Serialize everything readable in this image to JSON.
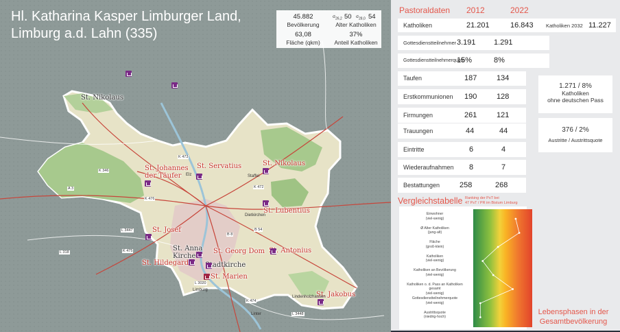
{
  "map": {
    "title_line1": "Hl. Katharina Kasper Limburger Land,",
    "title_line2": "Limburg a.d. Lahn (335)",
    "stats": {
      "bevoelkerung_value": "45.882",
      "bevoelkerung_label": "Bevölkerung",
      "sigma_a": "σ",
      "sigma_a_sub": "26,2",
      "alter_value": "50",
      "sigma_b": "σ",
      "sigma_b_sub": "28,0",
      "alter_value2": "54",
      "alter_label": "Alter Katholiken",
      "flaeche_value": "63,08",
      "flaeche_label": "Fläche (qkm)",
      "anteil_value": "37%",
      "anteil_label": "Anteil Katholiken"
    },
    "places": [
      {
        "id": "st-nikolaus-nord",
        "label": "St. Nikolaus"
      },
      {
        "id": "st-johannes",
        "label": "St. Johannes\nder Täufer"
      },
      {
        "id": "st-servatius",
        "label": "St. Servatius"
      },
      {
        "id": "st-nikolaus-ost",
        "label": "St. Nikolaus"
      },
      {
        "id": "st-lubentius",
        "label": "St. Lubentius"
      },
      {
        "id": "st-josef",
        "label": "St. Josef"
      },
      {
        "id": "st-anna",
        "label": "St. Anna\nKirche"
      },
      {
        "id": "st-georg",
        "label": "St. Georg Dom"
      },
      {
        "id": "stadtkirche",
        "label": "Stadtkirche"
      },
      {
        "id": "st-hildegard",
        "label": "St. Hildegard"
      },
      {
        "id": "st-antonius",
        "label": "St. Antonius"
      },
      {
        "id": "st-marien",
        "label": "St. Marien"
      },
      {
        "id": "st-jakobus",
        "label": "St. Jakobus"
      }
    ],
    "road_labels": [
      "A 3",
      "K 346",
      "L 3020",
      "K 472",
      "K 473",
      "B 8",
      "L 3447",
      "K 475",
      "B 54",
      "L 3448",
      "K 474",
      "L 318",
      "K 476"
    ],
    "town_labels": [
      "Elz",
      "Staffel",
      "Lindenholzhausen",
      "Linter",
      "Dietkirchen",
      "Limburg"
    ]
  },
  "pastoral": {
    "title": "Pastoraldaten",
    "year_a": "2012",
    "year_b": "2022",
    "rows": [
      {
        "label": "Katholiken",
        "a": "21.201",
        "b": "16.843",
        "extra_label": "Katholiken 2032",
        "extra_value": "11.227"
      },
      {
        "label": "Gottesdienstteilnehmer",
        "a": "3.191",
        "b": "1.291"
      },
      {
        "label": "Gottesdienstteilnehmerquote",
        "a": "15%",
        "b": "8%"
      },
      {
        "label": "Taufen",
        "a": "187",
        "b": "134"
      },
      {
        "label": "Erstkommunionen",
        "a": "190",
        "b": "128"
      },
      {
        "label": "Firmungen",
        "a": "261",
        "b": "121"
      },
      {
        "label": "Trauungen",
        "a": "44",
        "b": "44"
      },
      {
        "label": "Eintritte",
        "a": "6",
        "b": "4"
      },
      {
        "label": "Wiederaufnahmen",
        "a": "8",
        "b": "7"
      },
      {
        "label": "Bestattungen",
        "a": "258",
        "b": "268"
      }
    ],
    "side1_value": "1.271 / 8%",
    "side1_label1": "Katholiken",
    "side1_label2": "ohne deutschen Pass",
    "side2_value": "376 / 2%",
    "side2_label": "Austritte / Austrittsquote"
  },
  "vergleich": {
    "title": "Vergleichstabelle",
    "ranking_line1": "Ranking der PsT bei",
    "ranking_line2": "47 PsT / PR im Bistum Limburg",
    "indicators": [
      {
        "label": "Einwohner",
        "sub": "(viel-wenig)",
        "level": 0.72
      },
      {
        "label": "Ø Alter Katholiken",
        "sub": "(jung-alt)",
        "level": 0.78
      },
      {
        "label": "Fläche",
        "sub": "(groß-klein)",
        "level": 0.42
      },
      {
        "label": "Katholiken",
        "sub": "(viel-wenig)",
        "level": 0.16
      },
      {
        "label": "Katholiken an Bevölkerung",
        "sub": "(viel-wenig)",
        "level": 0.34
      },
      {
        "label": "Katholiken o. d. Pass an Katholiken gesamt",
        "sub": "(viel-wenig)",
        "level": 0.67
      },
      {
        "label": "Gottesdienstteilnehmerquote",
        "sub": "(viel-wenig)",
        "level": 0.12
      },
      {
        "label": "Austrittsquote",
        "sub": "(niedrig-hoch)",
        "level": 0.12
      }
    ],
    "lebensphasen_line1": "Lebensphasen in der",
    "lebensphasen_line2": "Gesamtbevölkerung",
    "colors": {
      "accent": "#e4574b",
      "green": "#2e8b47",
      "yellow": "#f2d23a",
      "red": "#e2432b"
    }
  }
}
